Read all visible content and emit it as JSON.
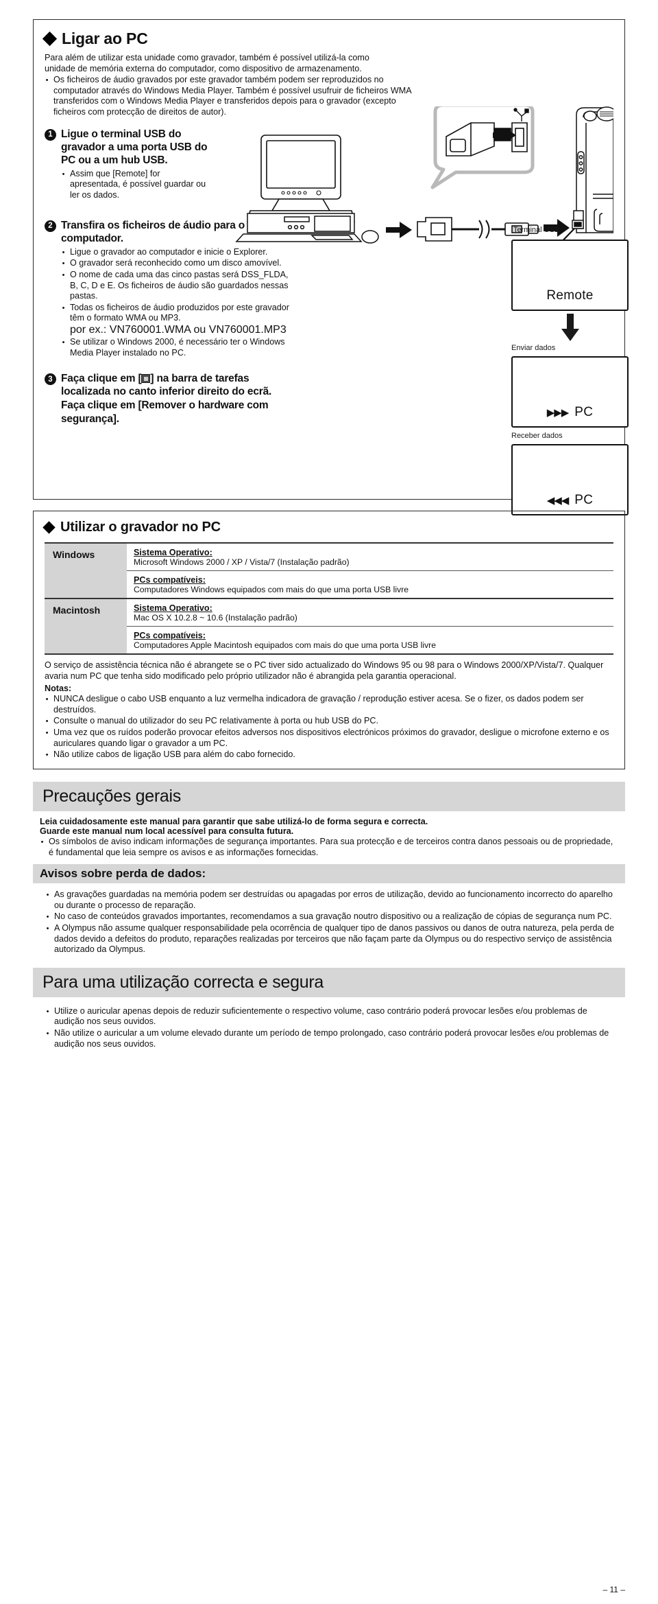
{
  "page": {
    "number": "– 11 –"
  },
  "section_pc": {
    "title": "Ligar ao PC",
    "intro": "Para além de utilizar esta unidade como gravador, também é possível utilizá-la como unidade de memória externa do computador, como dispositivo de armazenamento.",
    "intro_bullets": [
      "Os ficheiros de áudio gravados por este gravador também podem ser reproduzidos no computador através do Windows Media Player. Também é possível usufruir de ficheiros WMA transferidos com o Windows Media Player e transferidos depois para o gravador (excepto ficheiros com protecção de direitos de autor)."
    ],
    "steps": [
      {
        "num": "1",
        "heading": "Ligue o terminal USB do gravador a uma porta USB do PC ou a um hub USB.",
        "bullets": [
          "Assim que [Remote] for apresentada, é possível guardar ou ler os dados."
        ]
      },
      {
        "num": "2",
        "heading": "Transfira os ficheiros de áudio para o computador.",
        "bullets": [
          "Ligue o gravador ao computador e inicie o Explorer.",
          "O gravador será reconhecido como um disco amovível.",
          "O nome de cada uma das cinco pastas será DSS_FLDA, B, C, D e E. Os ficheiros de áudio são guardados nessas pastas.",
          "Todas os ficheiros de áudio produzidos por este gravador têm o formato WMA ou MP3.",
          "Se utilizar o Windows 2000, é necessário ter o Windows Media Player instalado no PC."
        ],
        "example": "por ex.:  VN760001.WMA ou VN760001.MP3"
      },
      {
        "num": "3",
        "heading_pre": "Faça clique em [",
        "heading_icon": "tray-icon",
        "heading_mid": "] na barra de tarefas localizada no canto inferior direito do ecrã.",
        "heading_line2_pre": "Faça clique em [",
        "heading_line2_bold": "Remover o hardware com segurança",
        "heading_line2_post": "]."
      }
    ],
    "illustration": {
      "usb_terminal_label": "Terminal USB",
      "lcd_remote": "Remote",
      "send_label": "Enviar dados",
      "receive_label": "Receber dados",
      "lcd_pc_send": "PC",
      "lcd_pc_receive": "PC",
      "send_triangles": "▶▶▶",
      "receive_triangles": "◀◀◀"
    }
  },
  "section_requirements": {
    "title": "Utilizar o gravador no PC",
    "table": {
      "rows": [
        {
          "platform": "Windows",
          "groups": [
            {
              "label": "Sistema Operativo:",
              "value": "Microsoft Windows 2000 / XP / Vista/7 (Instalação padrão)"
            },
            {
              "label": "PCs compatíveis:",
              "value": "Computadores Windows equipados com mais do que uma porta USB livre"
            }
          ]
        },
        {
          "platform": "Macintosh",
          "groups": [
            {
              "label": "Sistema Operativo:",
              "value": "Mac OS X 10.2.8 ~ 10.6 (Instalação padrão)"
            },
            {
              "label": "PCs compatíveis:",
              "value": "Computadores Apple Macintosh equipados com mais do que uma porta USB livre"
            }
          ]
        }
      ]
    },
    "note_paragraph": "O serviço de assistência técnica não é abrangete se o PC tiver sido actualizado do Windows 95 ou 98 para o Windows 2000/XP/Vista/7. Qualquer avaria num PC que tenha sido modificado pelo próprio utilizador não é abrangida pela garantia operacional.",
    "notes_label": "Notas:",
    "notes": [
      "NUNCA desligue o cabo USB enquanto a luz vermelha indicadora de gravação / reprodução estiver acesa. Se o fizer, os dados podem ser destruídos.",
      "Consulte o manual do utilizador do seu PC relativamente à porta ou hub USB do PC.",
      "Uma vez que os ruídos poderão provocar efeitos adversos nos dispositivos electrónicos próximos do gravador, desligue o microfone externo e os auriculares quando ligar o gravador a um PC.",
      "Não utilize cabos de ligação USB para além do cabo fornecido."
    ]
  },
  "section_precautions": {
    "title": "Precauções gerais",
    "lead_line1": "Leia cuidadosamente este manual para garantir que sabe utilizá-lo de forma segura e correcta.",
    "lead_line2": "Guarde este manual num local acessível para consulta futura.",
    "bullets": [
      "Os símbolos de aviso indicam informações de segurança importantes. Para sua protecção e de terceiros contra danos pessoais ou de propriedade, é fundamental que leia sempre os avisos e as informações fornecidas."
    ],
    "data_loss_title": "Avisos sobre perda de dados:",
    "data_loss_bullets": [
      "As gravações guardadas na memória podem ser destruídas ou apagadas por erros de utilização, devido ao funcionamento incorrecto do aparelho ou durante o processo de reparação.",
      "No caso de conteúdos gravados importantes, recomendamos a sua gravação noutro dispositivo ou a realização de cópias de segurança num PC.",
      "A Olympus não assume qualquer responsabilidade pela ocorrência de qualquer tipo de danos passivos ou danos de outra natureza, pela perda de dados devido a defeitos do produto, reparações realizadas por terceiros que não façam parte da Olympus ou do respectivo serviço de assistência autorizado da Olympus."
    ]
  },
  "section_safe_use": {
    "title": "Para uma utilização correcta e segura",
    "bullets": [
      "Utilize o auricular apenas depois de reduzir suficientemente o respectivo volume, caso contrário poderá provocar lesões e/ou problemas de audição nos seus ouvidos.",
      "Não utilize o auricular a um volume elevado durante um período de tempo prolongado, caso contrário poderá provocar lesões e/ou problemas de audição nos seus ouvidos."
    ]
  }
}
